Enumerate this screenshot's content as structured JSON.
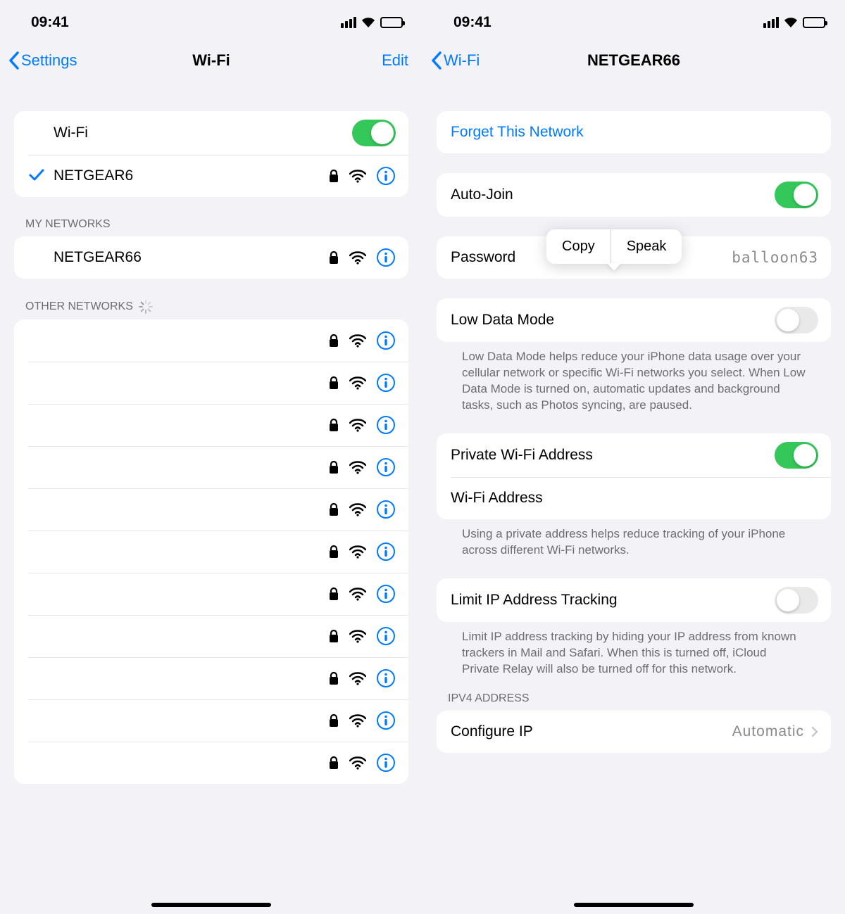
{
  "status": {
    "time": "09:41"
  },
  "left": {
    "nav": {
      "back": "Settings",
      "title": "Wi-Fi",
      "edit": "Edit"
    },
    "wifi_toggle_label": "Wi-Fi",
    "connected_network": "NETGEAR6",
    "sections": {
      "my_networks": "My Networks",
      "other_networks": "Other Networks"
    },
    "my_networks": [
      {
        "name": "NETGEAR66"
      }
    ],
    "other_networks_count": 11
  },
  "right": {
    "nav": {
      "back": "Wi-Fi",
      "title": "NETGEAR66"
    },
    "forget": "Forget This Network",
    "auto_join": "Auto-Join",
    "password_label": "Password",
    "password_value": "balloon63",
    "low_data": "Low Data Mode",
    "low_data_footer": "Low Data Mode helps reduce your iPhone data usage over your cellular network or specific Wi-Fi networks you select. When Low Data Mode is turned on, automatic updates and background tasks, such as Photos syncing, are paused.",
    "private_addr": "Private Wi-Fi Address",
    "wifi_addr": "Wi-Fi Address",
    "private_footer": "Using a private address helps reduce tracking of your iPhone across different Wi-Fi networks.",
    "limit_ip": "Limit IP Address Tracking",
    "limit_ip_footer": "Limit IP address tracking by hiding your IP address from known trackers in Mail and Safari. When this is turned off, iCloud Private Relay will also be turned off for this network.",
    "ipv4_header": "IPV4 Address",
    "configure_ip": "Configure IP",
    "configure_ip_value": "Automatic",
    "popover": {
      "copy": "Copy",
      "speak": "Speak"
    }
  }
}
